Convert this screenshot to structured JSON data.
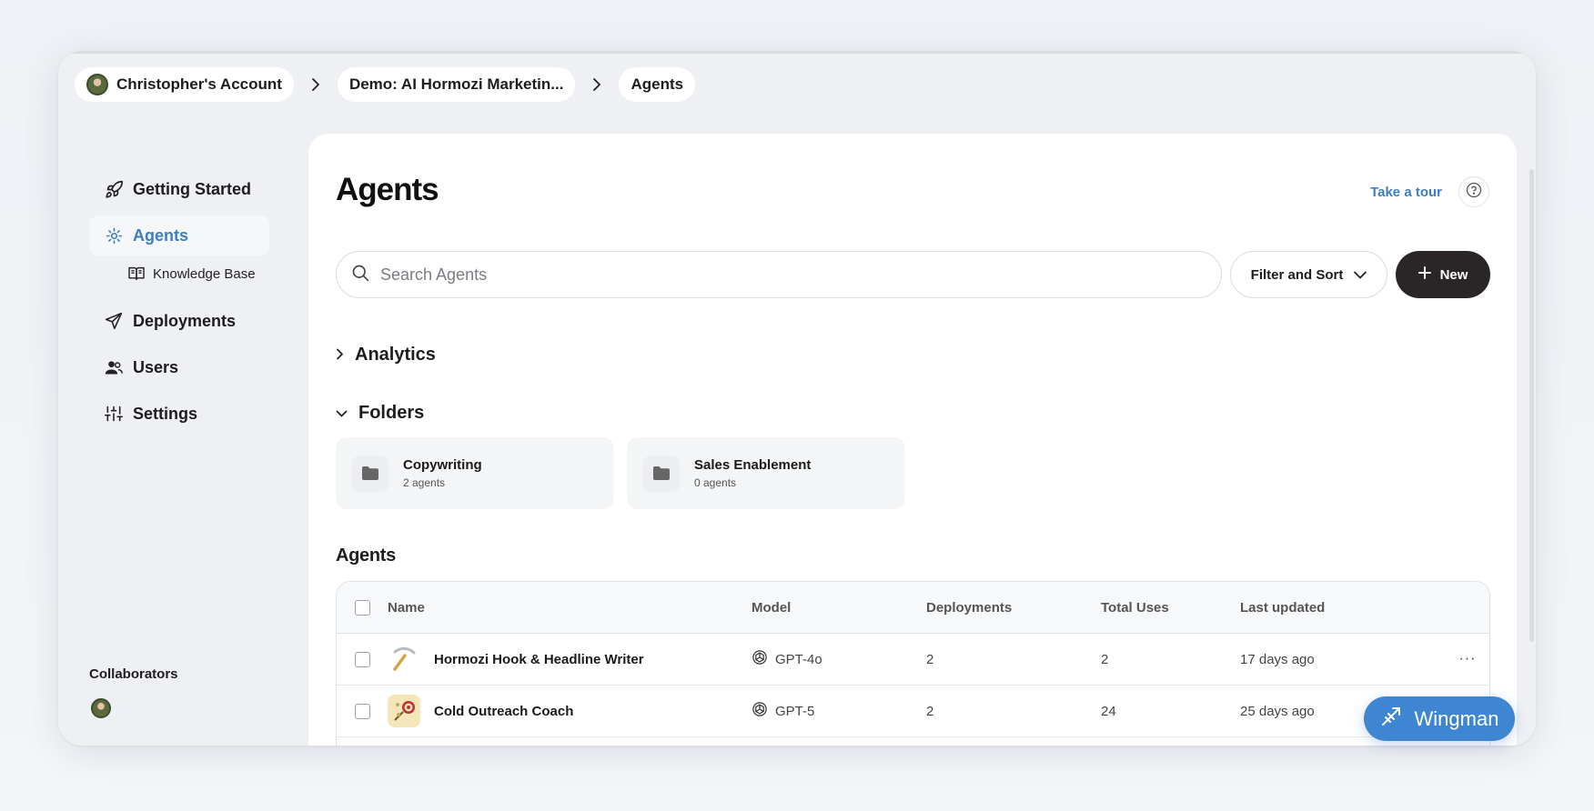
{
  "breadcrumb": {
    "account": "Christopher's Account",
    "project": "Demo: AI Hormozi Marketin...",
    "current": "Agents"
  },
  "sidebar": {
    "items": [
      {
        "label": "Getting Started",
        "icon": "rocket-icon"
      },
      {
        "label": "Agents",
        "icon": "agents-icon",
        "active": true
      },
      {
        "label": "Knowledge Base",
        "icon": "book-icon",
        "sub": true
      },
      {
        "label": "Deployments",
        "icon": "send-icon"
      },
      {
        "label": "Users",
        "icon": "users-icon"
      },
      {
        "label": "Settings",
        "icon": "sliders-icon"
      }
    ],
    "collaborators_label": "Collaborators"
  },
  "main": {
    "title": "Agents",
    "tour_label": "Take a tour",
    "search_placeholder": "Search Agents",
    "filter_label": "Filter and Sort",
    "new_label": "New",
    "analytics_label": "Analytics",
    "folders_label": "Folders",
    "folders": [
      {
        "name": "Copywriting",
        "count": "2 agents"
      },
      {
        "name": "Sales Enablement",
        "count": "0 agents"
      }
    ],
    "agents_heading": "Agents",
    "table": {
      "columns": [
        "Name",
        "Model",
        "Deployments",
        "Total Uses",
        "Last updated"
      ],
      "rows": [
        {
          "name": "Hormozi Hook & Headline Writer",
          "model": "GPT-4o",
          "deployments": "2",
          "uses": "2",
          "updated": "17 days ago"
        },
        {
          "name": "Cold Outreach Coach",
          "model": "GPT-5",
          "deployments": "2",
          "uses": "24",
          "updated": "25 days ago"
        }
      ]
    }
  },
  "wingman_label": "Wingman",
  "colors": {
    "accent": "#3b7fc4",
    "primary_button": "#2a2628",
    "wingman": "#3e86d1"
  }
}
